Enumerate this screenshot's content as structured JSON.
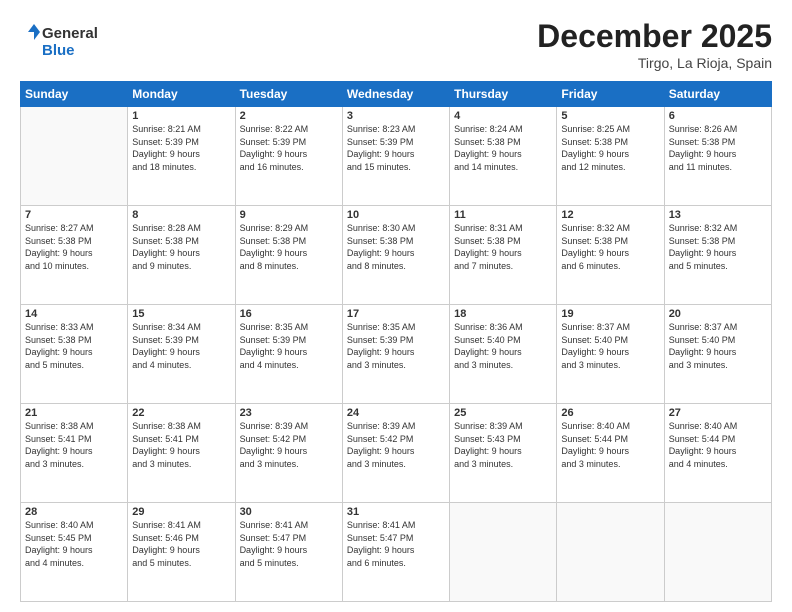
{
  "header": {
    "logo_general": "General",
    "logo_blue": "Blue",
    "month_title": "December 2025",
    "location": "Tirgo, La Rioja, Spain"
  },
  "weekdays": [
    "Sunday",
    "Monday",
    "Tuesday",
    "Wednesday",
    "Thursday",
    "Friday",
    "Saturday"
  ],
  "weeks": [
    [
      {
        "day": "",
        "info": ""
      },
      {
        "day": "1",
        "info": "Sunrise: 8:21 AM\nSunset: 5:39 PM\nDaylight: 9 hours\nand 18 minutes."
      },
      {
        "day": "2",
        "info": "Sunrise: 8:22 AM\nSunset: 5:39 PM\nDaylight: 9 hours\nand 16 minutes."
      },
      {
        "day": "3",
        "info": "Sunrise: 8:23 AM\nSunset: 5:39 PM\nDaylight: 9 hours\nand 15 minutes."
      },
      {
        "day": "4",
        "info": "Sunrise: 8:24 AM\nSunset: 5:38 PM\nDaylight: 9 hours\nand 14 minutes."
      },
      {
        "day": "5",
        "info": "Sunrise: 8:25 AM\nSunset: 5:38 PM\nDaylight: 9 hours\nand 12 minutes."
      },
      {
        "day": "6",
        "info": "Sunrise: 8:26 AM\nSunset: 5:38 PM\nDaylight: 9 hours\nand 11 minutes."
      }
    ],
    [
      {
        "day": "7",
        "info": "Sunrise: 8:27 AM\nSunset: 5:38 PM\nDaylight: 9 hours\nand 10 minutes."
      },
      {
        "day": "8",
        "info": "Sunrise: 8:28 AM\nSunset: 5:38 PM\nDaylight: 9 hours\nand 9 minutes."
      },
      {
        "day": "9",
        "info": "Sunrise: 8:29 AM\nSunset: 5:38 PM\nDaylight: 9 hours\nand 8 minutes."
      },
      {
        "day": "10",
        "info": "Sunrise: 8:30 AM\nSunset: 5:38 PM\nDaylight: 9 hours\nand 8 minutes."
      },
      {
        "day": "11",
        "info": "Sunrise: 8:31 AM\nSunset: 5:38 PM\nDaylight: 9 hours\nand 7 minutes."
      },
      {
        "day": "12",
        "info": "Sunrise: 8:32 AM\nSunset: 5:38 PM\nDaylight: 9 hours\nand 6 minutes."
      },
      {
        "day": "13",
        "info": "Sunrise: 8:32 AM\nSunset: 5:38 PM\nDaylight: 9 hours\nand 5 minutes."
      }
    ],
    [
      {
        "day": "14",
        "info": "Sunrise: 8:33 AM\nSunset: 5:38 PM\nDaylight: 9 hours\nand 5 minutes."
      },
      {
        "day": "15",
        "info": "Sunrise: 8:34 AM\nSunset: 5:39 PM\nDaylight: 9 hours\nand 4 minutes."
      },
      {
        "day": "16",
        "info": "Sunrise: 8:35 AM\nSunset: 5:39 PM\nDaylight: 9 hours\nand 4 minutes."
      },
      {
        "day": "17",
        "info": "Sunrise: 8:35 AM\nSunset: 5:39 PM\nDaylight: 9 hours\nand 3 minutes."
      },
      {
        "day": "18",
        "info": "Sunrise: 8:36 AM\nSunset: 5:40 PM\nDaylight: 9 hours\nand 3 minutes."
      },
      {
        "day": "19",
        "info": "Sunrise: 8:37 AM\nSunset: 5:40 PM\nDaylight: 9 hours\nand 3 minutes."
      },
      {
        "day": "20",
        "info": "Sunrise: 8:37 AM\nSunset: 5:40 PM\nDaylight: 9 hours\nand 3 minutes."
      }
    ],
    [
      {
        "day": "21",
        "info": "Sunrise: 8:38 AM\nSunset: 5:41 PM\nDaylight: 9 hours\nand 3 minutes."
      },
      {
        "day": "22",
        "info": "Sunrise: 8:38 AM\nSunset: 5:41 PM\nDaylight: 9 hours\nand 3 minutes."
      },
      {
        "day": "23",
        "info": "Sunrise: 8:39 AM\nSunset: 5:42 PM\nDaylight: 9 hours\nand 3 minutes."
      },
      {
        "day": "24",
        "info": "Sunrise: 8:39 AM\nSunset: 5:42 PM\nDaylight: 9 hours\nand 3 minutes."
      },
      {
        "day": "25",
        "info": "Sunrise: 8:39 AM\nSunset: 5:43 PM\nDaylight: 9 hours\nand 3 minutes."
      },
      {
        "day": "26",
        "info": "Sunrise: 8:40 AM\nSunset: 5:44 PM\nDaylight: 9 hours\nand 3 minutes."
      },
      {
        "day": "27",
        "info": "Sunrise: 8:40 AM\nSunset: 5:44 PM\nDaylight: 9 hours\nand 4 minutes."
      }
    ],
    [
      {
        "day": "28",
        "info": "Sunrise: 8:40 AM\nSunset: 5:45 PM\nDaylight: 9 hours\nand 4 minutes."
      },
      {
        "day": "29",
        "info": "Sunrise: 8:41 AM\nSunset: 5:46 PM\nDaylight: 9 hours\nand 5 minutes."
      },
      {
        "day": "30",
        "info": "Sunrise: 8:41 AM\nSunset: 5:47 PM\nDaylight: 9 hours\nand 5 minutes."
      },
      {
        "day": "31",
        "info": "Sunrise: 8:41 AM\nSunset: 5:47 PM\nDaylight: 9 hours\nand 6 minutes."
      },
      {
        "day": "",
        "info": ""
      },
      {
        "day": "",
        "info": ""
      },
      {
        "day": "",
        "info": ""
      }
    ]
  ]
}
